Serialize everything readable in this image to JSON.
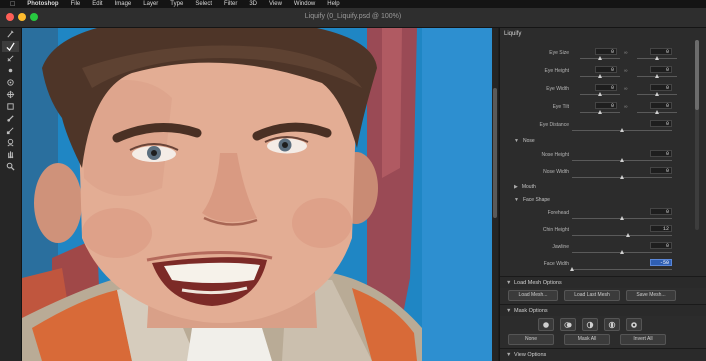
{
  "menubar": {
    "app": "Photoshop",
    "items": [
      "File",
      "Edit",
      "Image",
      "Layer",
      "Type",
      "Select",
      "Filter",
      "3D",
      "View",
      "Window",
      "Help"
    ]
  },
  "window": {
    "title": "Liquify (0_Liquify.psd @ 100%)",
    "traffic_lights": [
      "#ff5f57",
      "#febc2e",
      "#28c840"
    ]
  },
  "tools": [
    "lasso-icon",
    "brush-icon",
    "healing-icon",
    "eraser-icon",
    "bloat-icon",
    "pucker-icon",
    "push-icon",
    "freeze-icon",
    "thaw-icon",
    "face-icon",
    "hand-icon",
    "zoom-icon"
  ],
  "panel": {
    "title": "Liquify",
    "eyes": [
      {
        "label": "Eye Size",
        "left": "0",
        "right": "0",
        "linked": true
      },
      {
        "label": "Eye Height",
        "left": "0",
        "right": "0",
        "linked": true
      },
      {
        "label": "Eye Width",
        "left": "0",
        "right": "0",
        "linked": true
      },
      {
        "label": "Eye Tilt",
        "left": "0",
        "right": "0",
        "linked": true
      },
      {
        "label": "Eye Distance",
        "value": "0"
      }
    ],
    "nose_group": "Nose",
    "nose": [
      {
        "label": "Nose Height",
        "value": "0"
      },
      {
        "label": "Nose Width",
        "value": "0"
      }
    ],
    "mouth_group": "Mouth",
    "face_group": "Face Shape",
    "face": [
      {
        "label": "Forehead",
        "value": "0",
        "level": 0.5
      },
      {
        "label": "Chin Height",
        "value": "12",
        "level": 0.56
      },
      {
        "label": "Jawline",
        "value": "0",
        "level": 0.5
      },
      {
        "label": "Face Width",
        "value": "-50",
        "level": 0.25,
        "highlight": true
      }
    ],
    "load_mesh": {
      "title": "Load Mesh Options",
      "buttons": [
        "Load Mesh...",
        "Load Last Mesh",
        "Save Mesh..."
      ]
    },
    "mask": {
      "title": "Mask Options",
      "icons": [
        "replace-selection-icon",
        "add-to-selection-icon",
        "subtract-icon",
        "intersect-icon",
        "invert-icon"
      ],
      "buttons": [
        "None",
        "Mask All",
        "Invert All"
      ]
    },
    "view_options": "View Options"
  },
  "colors": {
    "canvas_wall": "#1f86c4",
    "panel_bg": "#2c2c2c",
    "highlight": "#2f5fb3"
  }
}
